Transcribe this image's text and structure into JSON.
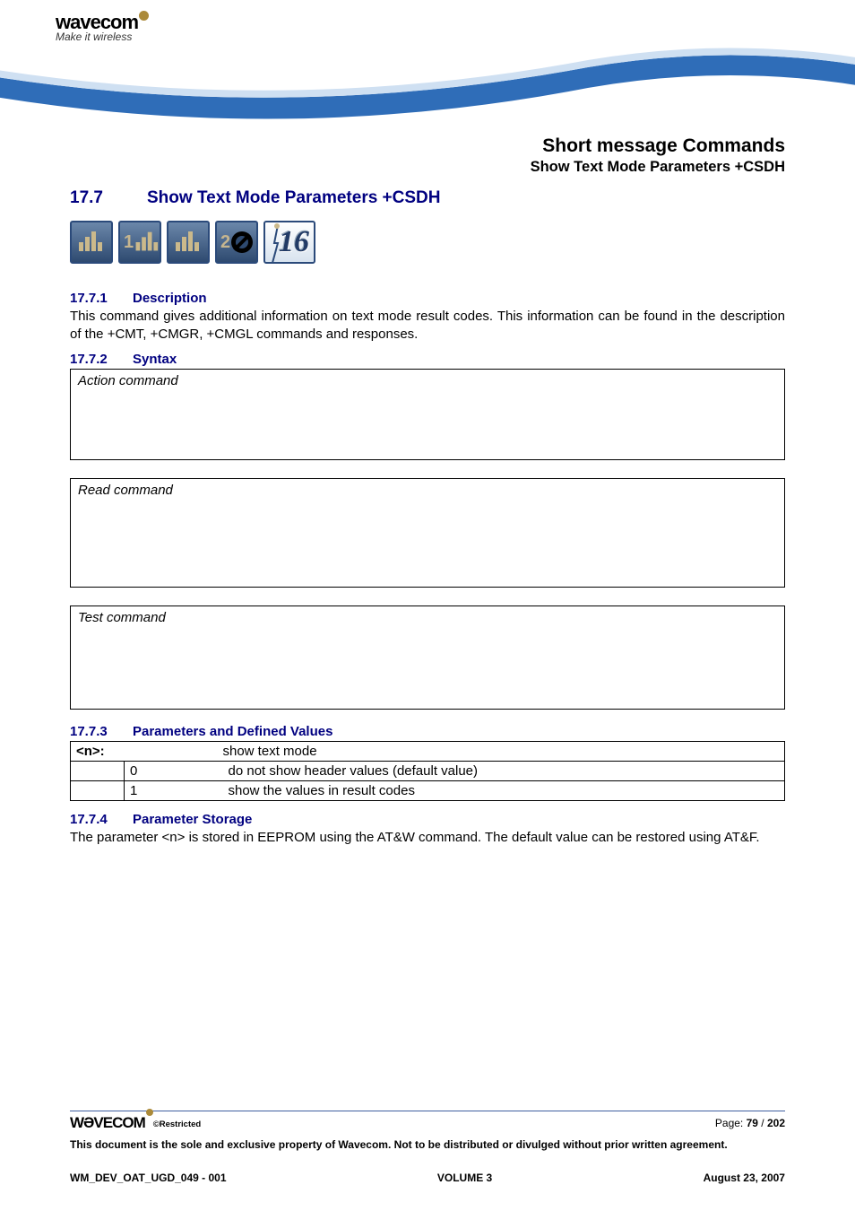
{
  "logo": {
    "brand": "wavecom",
    "tagline": "Make it wireless"
  },
  "doc": {
    "title": "Short message Commands",
    "subtitle": "Show Text Mode Parameters +CSDH"
  },
  "h2": {
    "num": "17.7",
    "title": "Show Text Mode Parameters +CSDH"
  },
  "icons": {
    "i2_n": "1",
    "i4_n": "2",
    "i5_t": "16"
  },
  "s1": {
    "num": "17.7.1",
    "title": "Description",
    "body": "This command gives additional information on text mode result codes. This information can be found in the description of the +CMT, +CMGR, +CMGL commands and responses."
  },
  "s2": {
    "num": "17.7.2",
    "title": "Syntax",
    "action_label": "Action command",
    "read_label": "Read command",
    "test_label": "Test command"
  },
  "s3": {
    "num": "17.7.3",
    "title": "Parameters and Defined Values",
    "param": "<n>:",
    "param_desc": "show text mode",
    "v0": "0",
    "d0": "do not show header values (default value)",
    "v1": "1",
    "d1": "show the values in result codes"
  },
  "s4": {
    "num": "17.7.4",
    "title": "Parameter Storage",
    "body": "The parameter <n> is stored in EEPROM using the AT&W command. The default value can be restored using AT&F."
  },
  "footer": {
    "brand": "WƏVECOM",
    "restricted": "©Restricted",
    "page_label": "Page: ",
    "page_cur": "79",
    "page_sep": " / ",
    "page_total": "202",
    "disclaimer": "This document is the sole and exclusive property of Wavecom. Not to be distributed or divulged without prior written agreement.",
    "docref": "WM_DEV_OAT_UGD_049 - 001",
    "volume": "VOLUME 3",
    "date": "August 23, 2007"
  }
}
